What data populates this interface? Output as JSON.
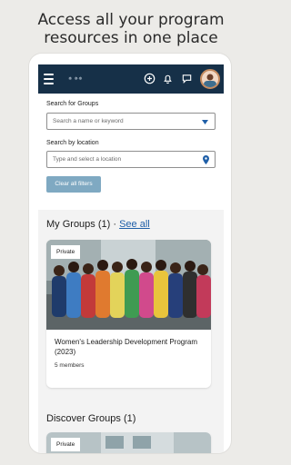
{
  "headline": {
    "line1": "Access all your program",
    "line2": "resources in one place"
  },
  "topbar": {
    "logo_text": "✵ ✵✵"
  },
  "search": {
    "label": "Search for Groups",
    "placeholder": "Search a name or keyword"
  },
  "location": {
    "label": "Search by location",
    "placeholder": "Type and select a location"
  },
  "clear_filters_label": "Clear all filters",
  "my_groups": {
    "title": "My Groups (1)",
    "separator": "·",
    "see_all": "See all"
  },
  "my_group_card": {
    "badge": "Private",
    "title": "Women's Leadership Development Program (2023)",
    "members": "5 members"
  },
  "discover_groups": {
    "title": "Discover Groups (1)"
  },
  "discover_card": {
    "badge": "Private"
  },
  "colors": {
    "topbar": "#163048",
    "accent_link": "#1f5fa8",
    "clear_button": "#7fa9c2"
  },
  "icons": [
    "menu-icon",
    "add-circle-icon",
    "bell-icon",
    "chat-icon",
    "avatar",
    "chevron-down-icon",
    "location-pin-icon"
  ]
}
